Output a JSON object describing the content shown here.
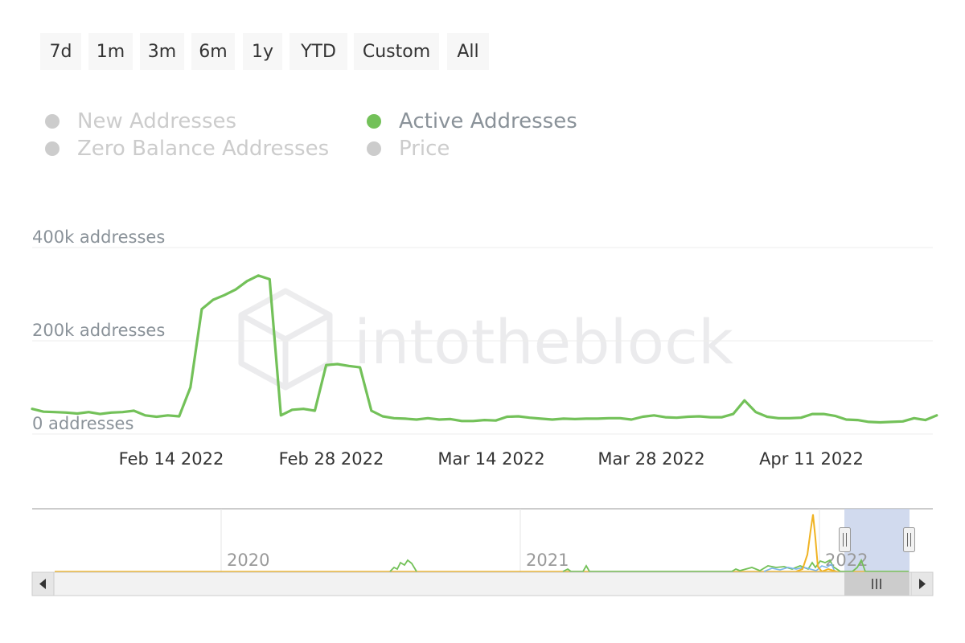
{
  "range_buttons": [
    "7d",
    "1m",
    "3m",
    "6m",
    "1y",
    "YTD",
    "Custom",
    "All"
  ],
  "legend": [
    {
      "label": "New Addresses",
      "visible": false,
      "color": "#7cb5ec"
    },
    {
      "label": "Active Addresses",
      "visible": true,
      "color": "#73c159"
    },
    {
      "label": "Zero Balance Addresses",
      "visible": false,
      "color": "#f0b323"
    },
    {
      "label": "Price",
      "visible": false,
      "color": "#cccccc"
    }
  ],
  "watermark": "intotheblock",
  "chart_data": {
    "type": "line",
    "series": [
      {
        "name": "Active Addresses",
        "color": "#73c159",
        "start_date": "2022-02-02",
        "interval_days": 1,
        "values": [
          54000,
          48000,
          47000,
          46000,
          44000,
          47000,
          43000,
          46000,
          47000,
          50000,
          40000,
          37000,
          40000,
          38000,
          100000,
          268000,
          288000,
          298000,
          310000,
          328000,
          340000,
          332000,
          40000,
          52000,
          54000,
          50000,
          148000,
          150000,
          146000,
          143000,
          50000,
          38000,
          34000,
          33000,
          31000,
          34000,
          31000,
          32000,
          28000,
          28000,
          30000,
          29000,
          37000,
          38000,
          35000,
          33000,
          31000,
          33000,
          32000,
          33000,
          33000,
          34000,
          34000,
          31000,
          37000,
          40000,
          36000,
          35000,
          37000,
          38000,
          36000,
          36000,
          43000,
          72000,
          47000,
          37000,
          34000,
          34000,
          35000,
          43000,
          43000,
          39000,
          31000,
          30000,
          26000,
          25000,
          26000,
          27000,
          34000,
          30000,
          40000
        ]
      }
    ],
    "y_ticks": [
      "0 addresses",
      "200k addresses",
      "400k addresses"
    ],
    "ylim": [
      0,
      400000
    ],
    "x_ticks": [
      "Feb 14 2022",
      "Feb 28 2022",
      "Mar 14 2022",
      "Mar 28 2022",
      "Apr 11 2022"
    ],
    "navigator": {
      "x_ticks": [
        "2020",
        "2021",
        "2022"
      ],
      "series_colors": [
        "#73c159",
        "#f0b323",
        "#7cb5ec"
      ],
      "selection": "Feb 2022 – Apr 2022"
    }
  }
}
